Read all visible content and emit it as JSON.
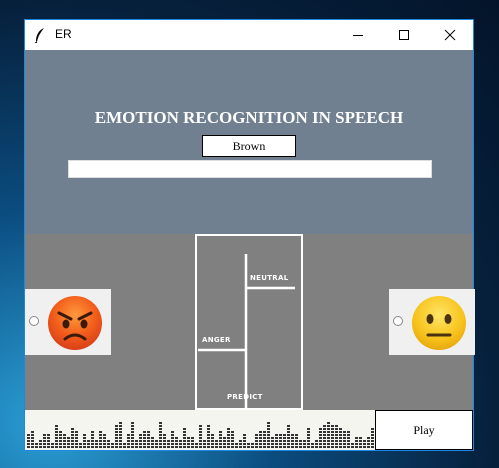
{
  "window": {
    "title": "ER",
    "controls": [
      "minimize-icon",
      "maximize-icon",
      "close-icon"
    ]
  },
  "header": {
    "title": "EMOTION RECOGNITION IN SPEECH",
    "button_label": "Brown",
    "input_value": ""
  },
  "emotions": {
    "left": {
      "icon": "angry-face-icon",
      "selected": false
    },
    "right": {
      "icon": "neutral-face-icon",
      "selected": false
    }
  },
  "predict": {
    "neutral_label": "NEUTRAL",
    "anger_label": "ANGER",
    "predict_label": "PREDICT"
  },
  "player": {
    "play_label": "Play",
    "waveform_icon": "audio-waveform-icon"
  },
  "colors": {
    "top_panel": "#708090",
    "mid_panel": "#808080",
    "window_border": "#1e88e5"
  }
}
